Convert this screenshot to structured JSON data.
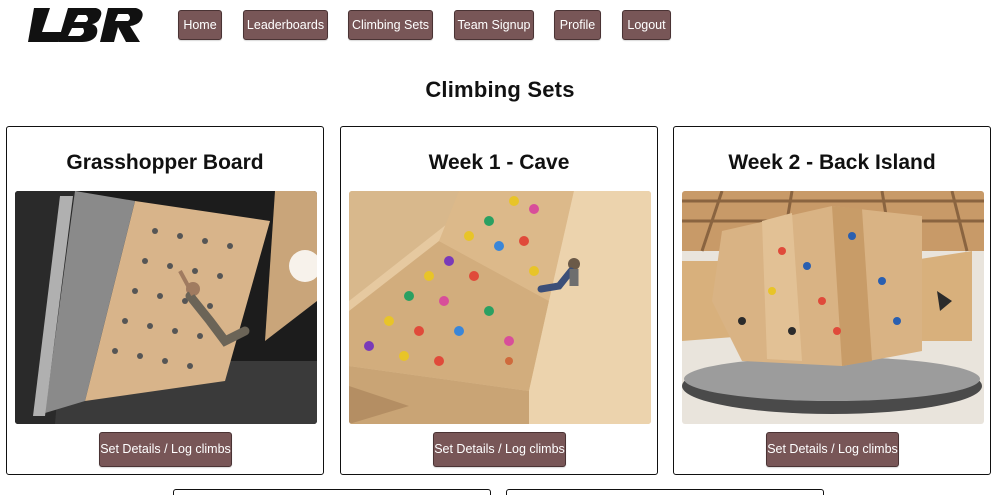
{
  "brand": {
    "logo_text": "LBR"
  },
  "nav": {
    "items": [
      {
        "label": "Home"
      },
      {
        "label": "Leaderboards"
      },
      {
        "label": "Climbing Sets"
      },
      {
        "label": "Team Signup"
      },
      {
        "label": "Profile"
      },
      {
        "label": "Logout"
      }
    ]
  },
  "page": {
    "title": "Climbing Sets"
  },
  "cards": [
    {
      "title": "Grasshopper Board",
      "button_label": "Set Details / Log climbs"
    },
    {
      "title": "Week 1 - Cave",
      "button_label": "Set Details / Log climbs"
    },
    {
      "title": "Week 2 - Back Island",
      "button_label": "Set Details / Log climbs"
    }
  ],
  "colors": {
    "button_bg": "#785657",
    "button_border": "#4a3334",
    "card_border": "#111111"
  }
}
